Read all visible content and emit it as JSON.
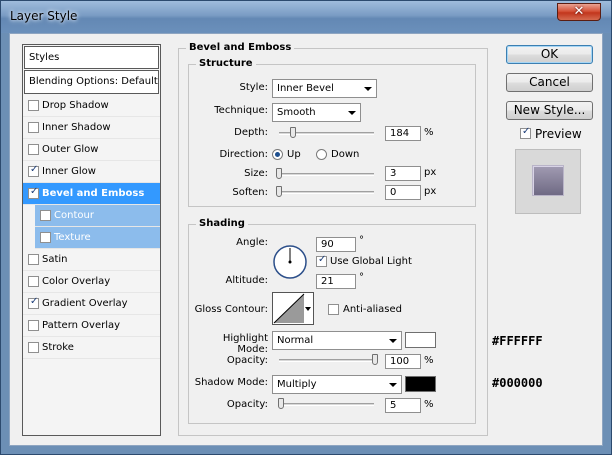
{
  "window": {
    "title": "Layer Style",
    "close_glyph": "✕"
  },
  "style_list": {
    "header": "Styles",
    "blending": "Blending Options: Default",
    "items": [
      {
        "label": "Drop Shadow",
        "checked": false
      },
      {
        "label": "Inner Shadow",
        "checked": false
      },
      {
        "label": "Outer Glow",
        "checked": false
      },
      {
        "label": "Inner Glow",
        "checked": true
      },
      {
        "label": "Bevel and Emboss",
        "checked": true,
        "selected": true
      },
      {
        "label": "Contour",
        "checked": false,
        "sub": true
      },
      {
        "label": "Texture",
        "checked": false,
        "sub": true
      },
      {
        "label": "Satin",
        "checked": false
      },
      {
        "label": "Color Overlay",
        "checked": false
      },
      {
        "label": "Gradient Overlay",
        "checked": true
      },
      {
        "label": "Pattern Overlay",
        "checked": false
      },
      {
        "label": "Stroke",
        "checked": false
      }
    ]
  },
  "bevel": {
    "title": "Bevel and Emboss",
    "structure": {
      "title": "Structure",
      "style_label": "Style:",
      "style_value": "Inner Bevel",
      "technique_label": "Technique:",
      "technique_value": "Smooth",
      "depth_label": "Depth:",
      "depth_value": "184",
      "depth_unit": "%",
      "direction_label": "Direction:",
      "direction_up": "Up",
      "direction_down": "Down",
      "direction_selected": "Up",
      "size_label": "Size:",
      "size_value": "3",
      "size_unit": "px",
      "soften_label": "Soften:",
      "soften_value": "0",
      "soften_unit": "px"
    },
    "shading": {
      "title": "Shading",
      "angle_label": "Angle:",
      "angle_value": "90",
      "angle_unit": "°",
      "global_light_label": "Use Global Light",
      "global_light_checked": true,
      "altitude_label": "Altitude:",
      "altitude_value": "21",
      "altitude_unit": "°",
      "gloss_label": "Gloss Contour:",
      "anti_aliased_label": "Anti-aliased",
      "anti_aliased_checked": false,
      "highlight_mode_label": "Highlight Mode:",
      "highlight_mode_value": "Normal",
      "highlight_color": "#FFFFFF",
      "highlight_opacity_label": "Opacity:",
      "highlight_opacity_value": "100",
      "highlight_opacity_unit": "%",
      "shadow_mode_label": "Shadow Mode:",
      "shadow_mode_value": "Multiply",
      "shadow_color": "#000000",
      "shadow_opacity_label": "Opacity:",
      "shadow_opacity_value": "5",
      "shadow_opacity_unit": "%"
    }
  },
  "buttons": {
    "ok": "OK",
    "cancel": "Cancel",
    "new_style": "New Style..."
  },
  "preview": {
    "label": "Preview",
    "checked": true
  },
  "annotations": {
    "highlight_hex": "#FFFFFF",
    "shadow_hex": "#000000"
  },
  "colors": {
    "selected_row": "#3399ff",
    "sub_row": "#8cbcec",
    "titlebar": "#7a9cc4"
  }
}
